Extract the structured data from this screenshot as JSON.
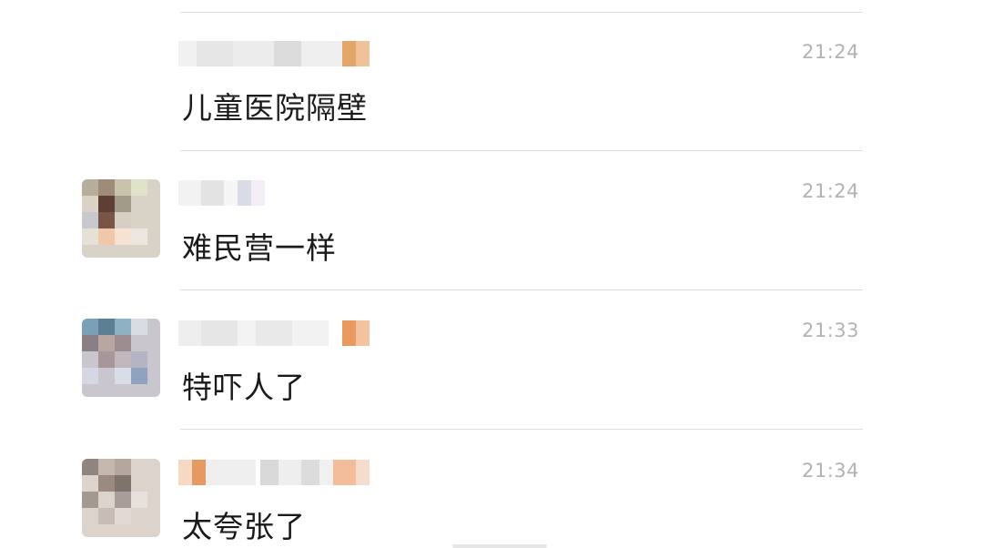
{
  "comments": [
    {
      "time": "21:24",
      "text": "儿童医院隔壁",
      "has_avatar": false
    },
    {
      "time": "21:24",
      "text": "难民营一样",
      "has_avatar": true
    },
    {
      "time": "21:33",
      "text": "特吓人了",
      "has_avatar": true
    },
    {
      "time": "21:34",
      "text": "太夸张了",
      "has_avatar": true
    }
  ],
  "colors": {
    "divider": "#dedede",
    "timestamp": "#b2b2b2",
    "text": "#1a1a1a"
  }
}
